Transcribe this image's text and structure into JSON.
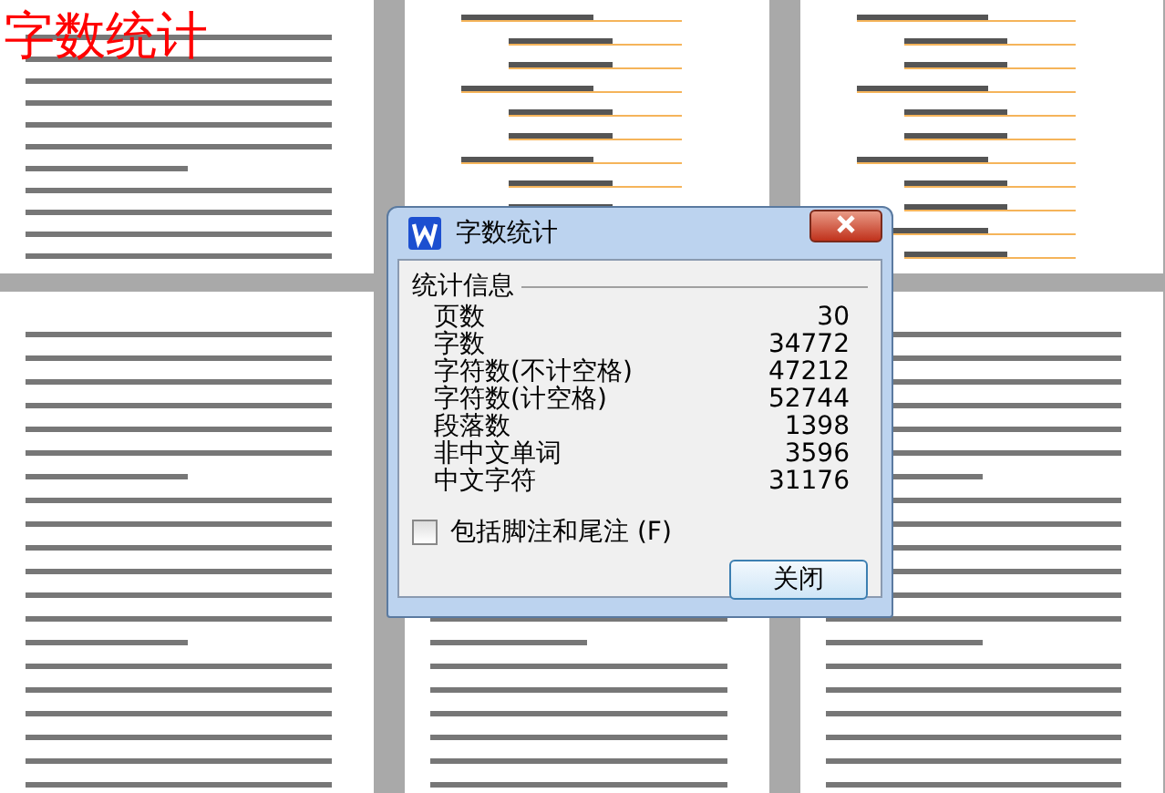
{
  "caption": "字数统计",
  "dialog": {
    "title": "字数统计",
    "group_label": "统计信息",
    "stats": [
      {
        "label": "页数",
        "value": "30"
      },
      {
        "label": "字数",
        "value": "34772"
      },
      {
        "label": "字符数(不计空格)",
        "value": "47212"
      },
      {
        "label": "字符数(计空格)",
        "value": "52744"
      },
      {
        "label": "段落数",
        "value": "1398"
      },
      {
        "label": "非中文单词",
        "value": "3596"
      },
      {
        "label": "中文字符",
        "value": "31176"
      }
    ],
    "checkbox": {
      "label": "包括脚注和尾注 (F)",
      "checked": false
    },
    "button": "关闭"
  }
}
